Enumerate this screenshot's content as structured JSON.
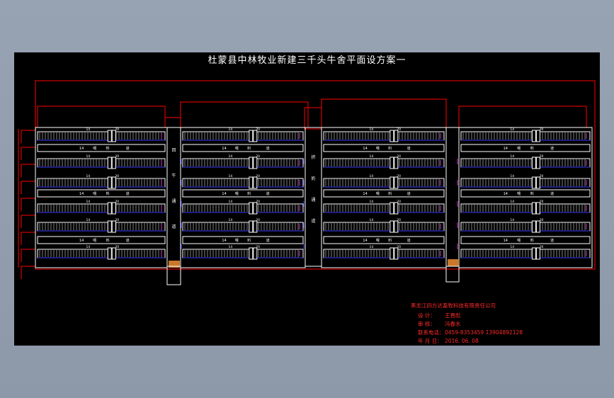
{
  "title": "杜蒙县中林牧业新建三千头牛舍平面设方案一",
  "title_block": {
    "company": "黑龙江四方达畜牧科技有限责任公司",
    "designer_label": "设   计：",
    "designer": "王晋彪",
    "reviewer_label": "审   核：",
    "reviewer": "冯春水",
    "phone_label": "联系电话：",
    "phone": "0459-8353459   13904892128",
    "date_label": "年 月 日：",
    "date": "2016. 06. 08"
  },
  "corridor_labels": {
    "left": [
      "回",
      "牛",
      "通",
      "道"
    ],
    "mid": [
      "挤",
      "奶",
      "通",
      "道"
    ]
  },
  "alley_labels": [
    "14",
    "喂",
    "料",
    "道"
  ],
  "colors": {
    "background": "#000000",
    "outline": "#ff0000",
    "stall_line": "#ffffff",
    "accent_blue": "#3b3bff",
    "accent_magenta": "#cc33cc",
    "title": "#ffffff",
    "title_block_text": "#ff2a2a"
  }
}
